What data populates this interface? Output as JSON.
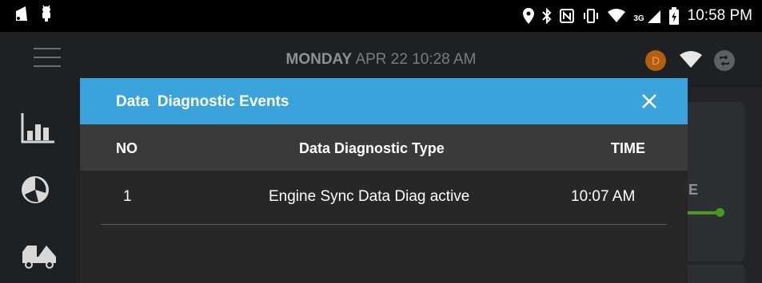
{
  "status_bar": {
    "time": "10:58 PM",
    "network_label": "3G"
  },
  "header": {
    "day": "MONDAY",
    "date_time": "APR 22 10:28 AM",
    "avatar_letter": "D"
  },
  "background_card": {
    "visible_letter": "E"
  },
  "dialog": {
    "title": "Data  Diagnostic Events",
    "columns": {
      "no": "NO",
      "type": "Data Diagnostic Type",
      "time": "TIME"
    },
    "rows": [
      {
        "no": "1",
        "type": "Engine Sync Data Diag active",
        "time": "10:07 AM"
      }
    ]
  },
  "colors": {
    "dialog_header": "#3ba3dc",
    "table_header": "#3a3a3a",
    "dialog_body": "#272727",
    "avatar": "#b25f12",
    "progress": "#4a9a22"
  },
  "icons": [
    "notification-icon",
    "android-debug-icon",
    "location-icon",
    "bluetooth-icon",
    "nfc-icon",
    "vibrate-icon",
    "wifi-icon",
    "signal-icon",
    "battery-charging-icon",
    "menu-icon",
    "sync-icon",
    "chart-icon",
    "engine-icon",
    "truck-icon",
    "close-icon"
  ]
}
